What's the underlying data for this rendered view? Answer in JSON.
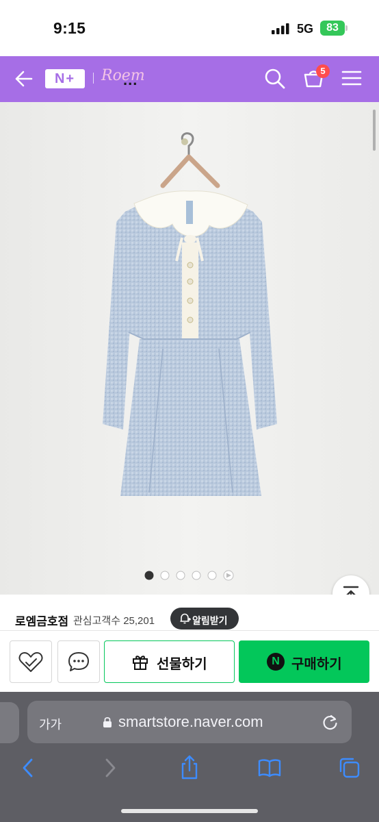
{
  "status_bar": {
    "time": "9:15",
    "network": "5G",
    "battery": "83"
  },
  "header": {
    "logo_text": "N+",
    "brand": "Roem",
    "brand_suffix": "...",
    "cart_count": "5",
    "icons": [
      "back-arrow-icon",
      "search-icon",
      "cart-icon",
      "menu-icon"
    ],
    "accent_color": "#a66ee6"
  },
  "gallery": {
    "image_count": 5,
    "active_index": 0,
    "has_video": true
  },
  "store": {
    "name": "로엠금호점",
    "fans_label": "관심고객수",
    "fans_count": "25,201",
    "alarm_button": "알림받기"
  },
  "actions": {
    "gift_label": "선물하기",
    "buy_label": "구매하기",
    "buy_logo": "N",
    "buy_color": "#03c75a"
  },
  "browser": {
    "text_size": "가가",
    "url": "smartstore.naver.com"
  }
}
